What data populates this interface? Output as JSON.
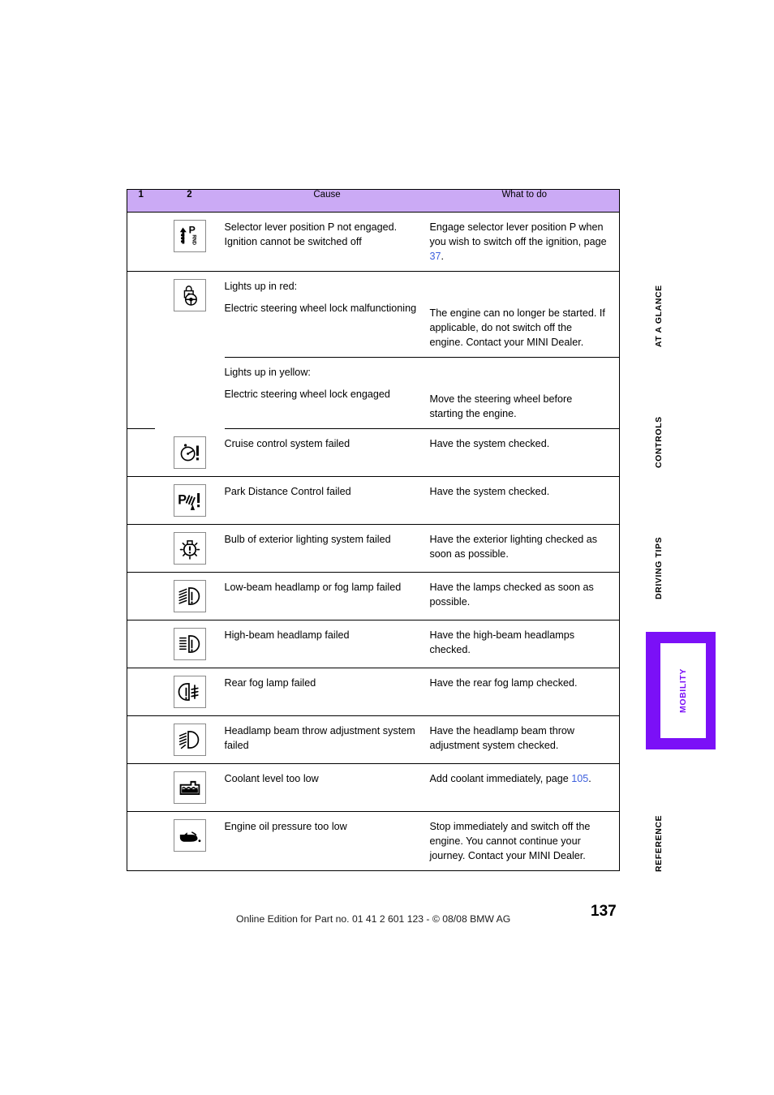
{
  "table": {
    "headers": {
      "col1": "1",
      "col2": "2",
      "cause": "Cause",
      "what_to_do": "What to do"
    },
    "rows": [
      {
        "icon": "selector-lever-prnd-icon",
        "cause": "Selector lever position P not engaged. Ignition cannot be switched off",
        "what_to_do_pre": "Engage selector lever position P when you wish to switch off the ignition, page ",
        "what_to_do_link": "37",
        "what_to_do_post": "."
      },
      {
        "icon": "steering-wheel-lock-icon",
        "sub": [
          {
            "heading": "Lights up in red:",
            "cause": "Electric steering wheel lock malfunctioning",
            "what_to_do": "The engine can no longer be started. If applicable, do not switch off the engine. Contact your MINI Dealer."
          },
          {
            "heading": "Lights up in yellow:",
            "cause": "Electric steering wheel lock engaged",
            "what_to_do": "Move the steering wheel before starting the engine."
          }
        ]
      },
      {
        "icon": "cruise-control-icon",
        "cause": "Cruise control system failed",
        "what_to_do": "Have the system checked."
      },
      {
        "icon": "park-distance-control-icon",
        "cause": "Park Distance Control failed",
        "what_to_do": "Have the system checked."
      },
      {
        "icon": "exterior-bulb-icon",
        "cause": "Bulb of exterior lighting system failed",
        "what_to_do": "Have the exterior lighting checked as soon as possible."
      },
      {
        "icon": "low-beam-headlamp-icon",
        "cause": "Low-beam headlamp or fog lamp failed",
        "what_to_do": "Have the lamps checked as soon as possible."
      },
      {
        "icon": "high-beam-headlamp-icon",
        "cause": "High-beam headlamp failed",
        "what_to_do": "Have the high-beam headlamps checked."
      },
      {
        "icon": "rear-fog-lamp-icon",
        "cause": "Rear fog lamp failed",
        "what_to_do": "Have the rear fog lamp checked."
      },
      {
        "icon": "headlamp-beam-throw-icon",
        "cause": "Headlamp beam throw adjustment system failed",
        "what_to_do": "Have the headlamp beam throw adjustment system checked."
      },
      {
        "icon": "coolant-level-icon",
        "cause": "Coolant level too low",
        "what_to_do_pre": "Add coolant immediately, page ",
        "what_to_do_link": "105",
        "what_to_do_post": "."
      },
      {
        "icon": "engine-oil-pressure-icon",
        "cause": "Engine oil pressure too low",
        "what_to_do": "Stop immediately and switch off the engine. You cannot continue your journey. Contact your MINI Dealer."
      }
    ]
  },
  "side_tabs": {
    "at_a_glance": "AT A GLANCE",
    "controls": "CONTROLS",
    "driving_tips": "DRIVING TIPS",
    "mobility": "MOBILITY",
    "reference": "REFERENCE"
  },
  "footer": {
    "note": "Online Edition for Part no. 01 41 2 601 123  - © 08/08 BMW AG",
    "page_number": "137"
  },
  "colors": {
    "header_band": "#cbaaf5",
    "accent_purple": "#7b10f7",
    "page_ref_link": "#3d5fdd"
  }
}
